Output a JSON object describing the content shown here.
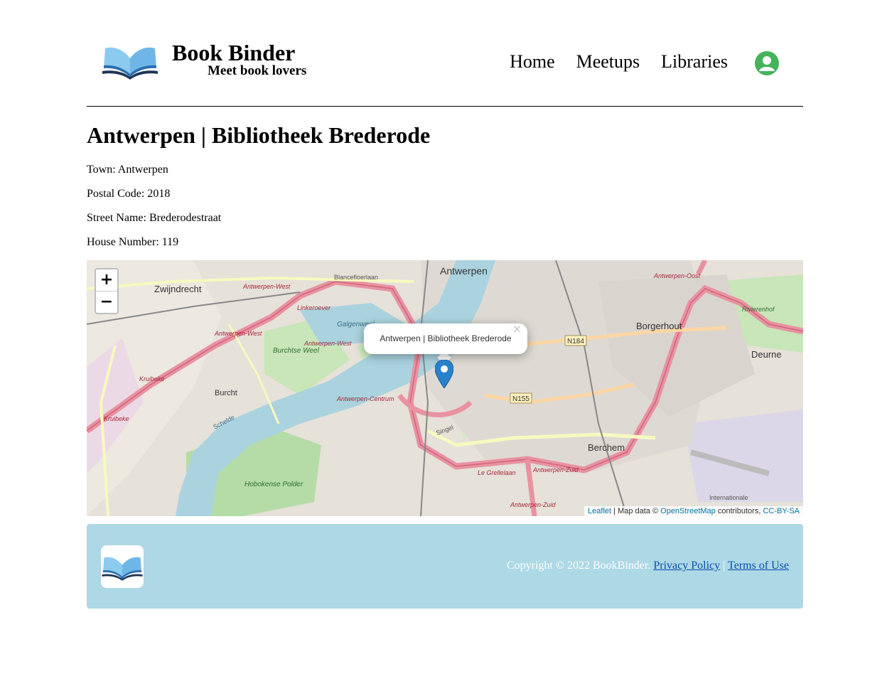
{
  "header": {
    "brand_title": "Book Binder",
    "brand_subtitle": "Meet book lovers",
    "nav": [
      "Home",
      "Meetups",
      "Libraries"
    ]
  },
  "library": {
    "title": "Antwerpen | Bibliotheek Brederode",
    "town": "Town: Antwerpen",
    "postal_code": "Postal Code: 2018",
    "street_name": "Street Name: Brederodestraat",
    "house_number": "House Number: 119"
  },
  "map": {
    "popup_text": "Antwerpen | Bibliotheek Brederode",
    "zoom_in": "+",
    "zoom_out": "−",
    "popup_close": "×",
    "attribution": {
      "leaflet": "Leaflet",
      "sep": " | Map data © ",
      "osm": "OpenStreetMap",
      "contributors": " contributors, ",
      "license": "CC-BY-SA"
    },
    "labels": {
      "antwerpen": "Antwerpen",
      "zwijndrecht": "Zwijndrecht",
      "borgerhout": "Borgerhout",
      "deurne": "Deurne",
      "berchem": "Berchem",
      "burcht": "Burcht",
      "galgenweel": "Galgenweel",
      "burchtse_weel": "Burchtse Weel",
      "hobokense_polder": "Hobokense Polder",
      "n184": "N184",
      "n155": "N155",
      "antwerpen_west": "Antwerpen-West",
      "antwerpen_oost": "Antwerpen-Oost",
      "antwerpen_zuid": "Antwerpen-Zuid",
      "antwerpen_centrum": "Antwerpen-Centrum",
      "linkeroever": "Linkeroever",
      "kruibeke": "Kruibeke",
      "rivierenhof": "Rivierenhof",
      "singel": "Singel",
      "blancefloerlaan": "Blancefloerlaan",
      "internationale": "Internationale",
      "le_grellelaan": "Le Grellelaan",
      "schelde": "Schelde"
    },
    "colors": {
      "water": "#aad3df",
      "motorway": "#e892a2",
      "park": "#c8facc",
      "marker": "#2a81cb"
    }
  },
  "footer": {
    "copyright": "Copyright © 2022 BookBinder.",
    "privacy": "Privacy Policy",
    "sep": "|",
    "terms": "Terms of Use"
  }
}
